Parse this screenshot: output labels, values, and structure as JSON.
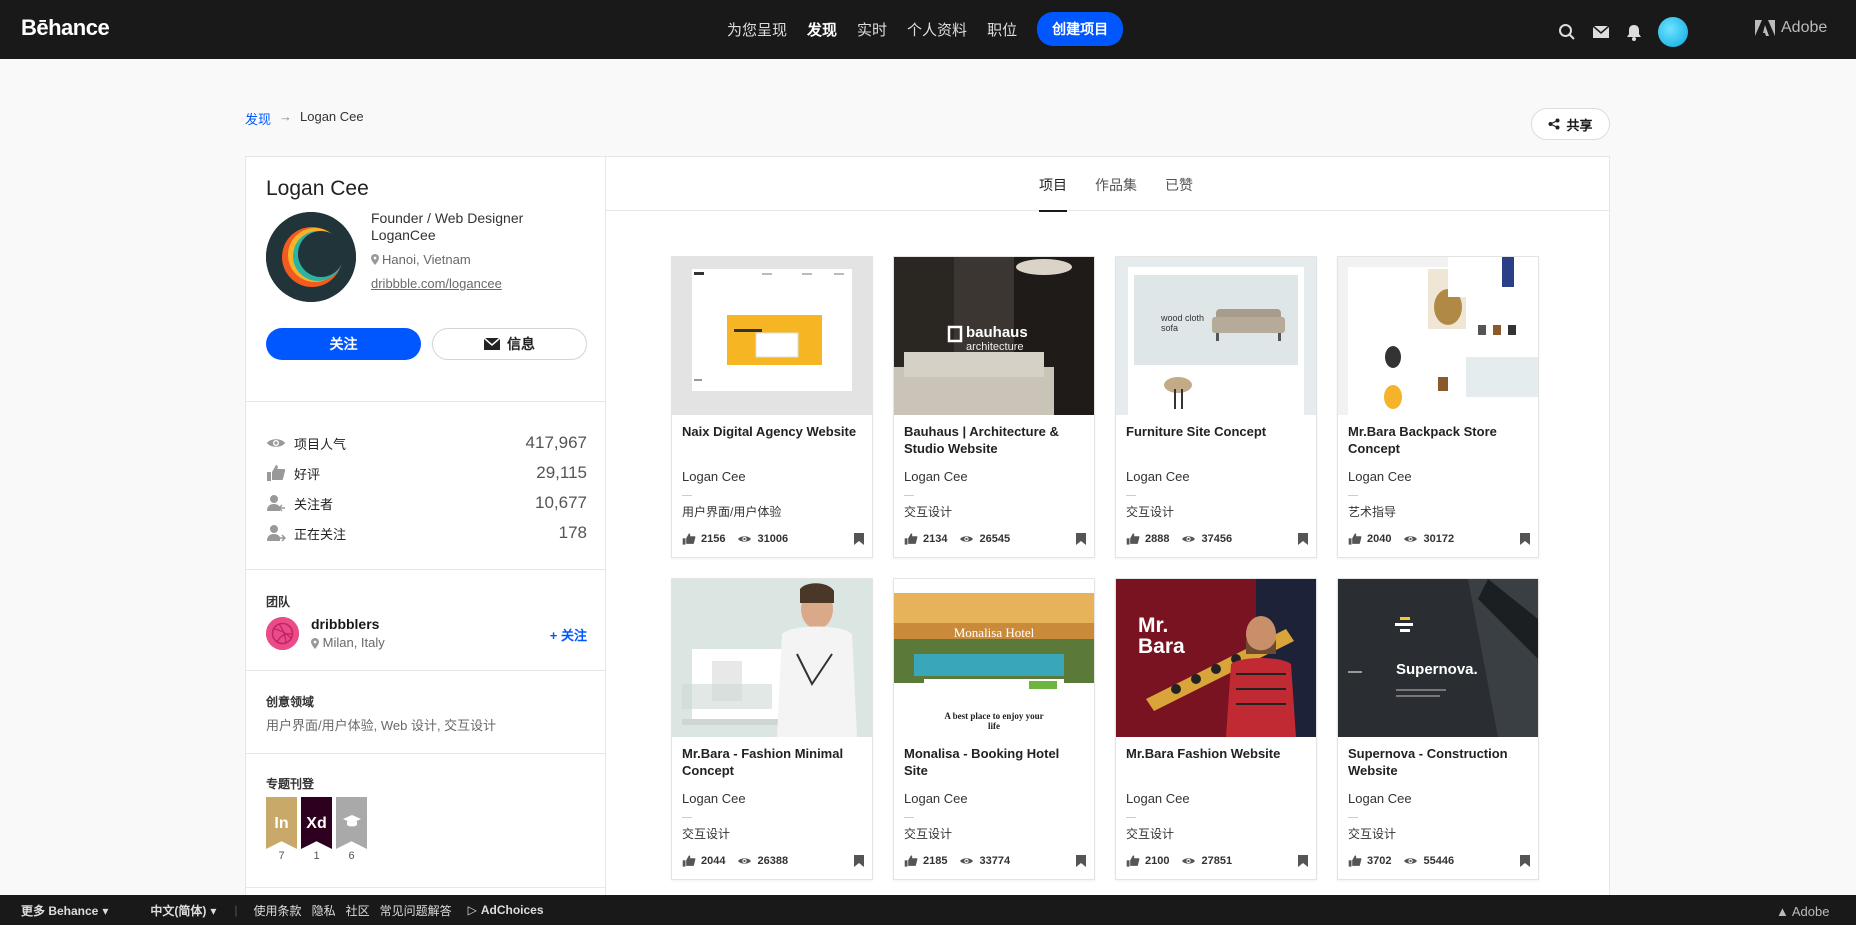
{
  "header": {
    "logo": "Bēhance",
    "nav": [
      "为您呈现",
      "发现",
      "实时",
      "个人资料",
      "职位"
    ],
    "active_nav": "发现",
    "create_label": "创建项目",
    "adobe_label": "Adobe"
  },
  "breadcrumb": {
    "link": "发现",
    "arrow": "→",
    "current": "Logan Cee"
  },
  "share_label": "共享",
  "profile": {
    "name": "Logan Cee",
    "title": "Founder / Web Designer",
    "company": "LoganCee",
    "location": "Hanoi, Vietnam",
    "website": "dribbble.com/logancee",
    "follow_label": "关注",
    "message_label": "信息"
  },
  "stats": [
    {
      "icon": "eye-icon",
      "label": "项目人气",
      "value": "417,967"
    },
    {
      "icon": "thumbs-up-icon",
      "label": "好评",
      "value": "29,115"
    },
    {
      "icon": "followers-icon",
      "label": "关注者",
      "value": "10,677"
    },
    {
      "icon": "following-icon",
      "label": "正在关注",
      "value": "178"
    }
  ],
  "team": {
    "title": "团队",
    "name": "dribbblers",
    "location": "Milan, Italy",
    "follow_label": "+ 关注"
  },
  "creative_fields": {
    "title": "创意领域",
    "value": "用户界面/用户体验, Web 设计, 交互设计"
  },
  "features": {
    "title": "专题刊登",
    "badges": [
      {
        "text": "In",
        "count": "7",
        "color": "#c8a96a"
      },
      {
        "text": "Xd",
        "count": "1",
        "color": "#2e001f"
      },
      {
        "text": "",
        "count": "6",
        "color": "#a9a9a9"
      }
    ]
  },
  "tabs": [
    "项目",
    "作品集",
    "已赞"
  ],
  "active_tab": "项目",
  "projects": [
    {
      "title": "Naix Digital Agency Website",
      "owner": "Logan Cee",
      "field": "用户界面/用户体验",
      "likes": "2156",
      "views": "31006"
    },
    {
      "title": "Bauhaus | Architecture & Studio Website",
      "owner": "Logan Cee",
      "field": "交互设计",
      "likes": "2134",
      "views": "26545",
      "thumb_text": "bauhaus",
      "thumb_sub": "architecture"
    },
    {
      "title": "Furniture Site Concept",
      "owner": "Logan Cee",
      "field": "交互设计",
      "likes": "2888",
      "views": "37456",
      "thumb_text": "wood cloth sofa"
    },
    {
      "title": "Mr.Bara Backpack Store Concept",
      "owner": "Logan Cee",
      "field": "艺术指导",
      "likes": "2040",
      "views": "30172"
    },
    {
      "title": "Mr.Bara - Fashion Minimal Concept",
      "owner": "Logan Cee",
      "field": "交互设计",
      "likes": "2044",
      "views": "26388"
    },
    {
      "title": "Monalisa - Booking Hotel Site",
      "owner": "Logan Cee",
      "field": "交互设计",
      "likes": "2185",
      "views": "33774",
      "thumb_text": "Monalisa Hotel",
      "thumb_sub": "A best place to enjoy your life"
    },
    {
      "title": "Mr.Bara Fashion Website",
      "owner": "Logan Cee",
      "field": "交互设计",
      "likes": "2100",
      "views": "27851",
      "thumb_text": "Mr. Bara"
    },
    {
      "title": "Supernova - Construction Website",
      "owner": "Logan Cee",
      "field": "交互设计",
      "likes": "3702",
      "views": "55446",
      "thumb_text": "Supernova."
    }
  ],
  "footer": {
    "more": "更多 Behance",
    "language": "中文(简体)",
    "links": [
      "使用条款",
      "隐私",
      "社区",
      "常见问题解答"
    ],
    "adchoices": "AdChoices",
    "adobe": "Adobe"
  },
  "colors": {
    "accent": "#0057ff",
    "topbar": "#191919",
    "footer": "#191919"
  }
}
